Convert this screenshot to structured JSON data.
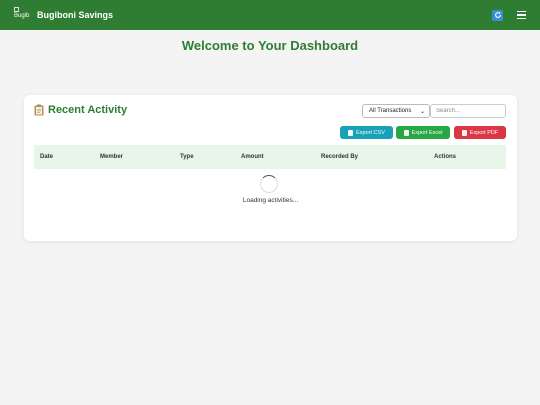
{
  "navbar": {
    "logo_alt": "Bugib",
    "brand": "Bugiboni Savings"
  },
  "page_title": "Welcome to Your Dashboard",
  "activity": {
    "title": "Recent Activity",
    "filter_selected": "All Transactions",
    "search_placeholder": "Search...",
    "export_csv": "Export CSV",
    "export_excel": "Export Excel",
    "export_pdf": "Export PDF",
    "columns": [
      "Date",
      "Member",
      "Type",
      "Amount",
      "Recorded By",
      "Actions"
    ],
    "loading_text": "Loading activities..."
  },
  "colors": {
    "brand_green": "#2e7d32",
    "csv": "#17a2b8",
    "excel": "#28a745",
    "pdf": "#dc3545",
    "table_header": "#e8f5e9"
  }
}
